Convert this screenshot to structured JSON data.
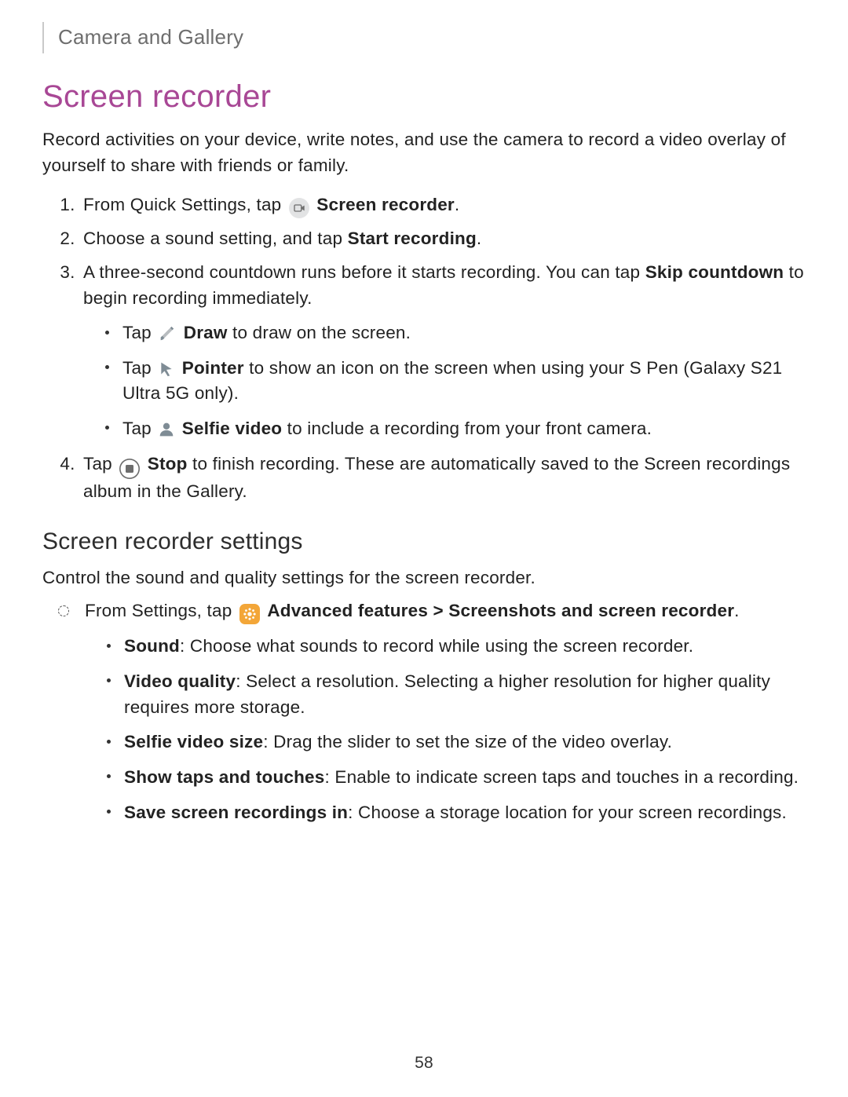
{
  "breadcrumb": "Camera and Gallery",
  "title": "Screen recorder",
  "intro": "Record activities on your device, write notes, and use the camera to record a video overlay of yourself to share with friends or family.",
  "steps": {
    "s1_pre": "From Quick Settings, tap ",
    "s1_label": "Screen recorder",
    "s1_post": ".",
    "s2_pre": "Choose a sound setting, and tap ",
    "s2_label": "Start recording",
    "s2_post": ".",
    "s3_pre": "A three-second countdown runs before it starts recording. You can tap ",
    "s3_label1": "Skip countdown",
    "s3_mid": " to begin recording immediately.",
    "s3_b1_pre": "Tap ",
    "s3_b1_label": "Draw",
    "s3_b1_post": " to draw on the screen.",
    "s3_b2_pre": "Tap ",
    "s3_b2_label": "Pointer",
    "s3_b2_post": " to show an icon on the screen when using your S Pen (Galaxy S21 Ultra 5G only).",
    "s3_b3_pre": "Tap ",
    "s3_b3_label": "Selfie video",
    "s3_b3_post": " to include a recording from your front camera.",
    "s4_pre": "Tap ",
    "s4_label": "Stop",
    "s4_post": " to finish recording. These are automatically saved to the Screen recordings album in the Gallery."
  },
  "subhead": "Screen recorder settings",
  "sub_intro": "Control the sound and quality settings for the screen recorder.",
  "settings_path": {
    "pre": "From Settings, tap ",
    "label": "Advanced features > Screenshots and screen recorder",
    "post": "."
  },
  "settings": {
    "b1_label": "Sound",
    "b1_text": ": Choose what sounds to record while using the screen recorder.",
    "b2_label": "Video quality",
    "b2_text": ": Select a resolution. Selecting a higher resolution for higher quality requires more storage.",
    "b3_label": "Selfie video size",
    "b3_text": ": Drag the slider to set the size of the video overlay.",
    "b4_label": "Show taps and touches",
    "b4_text": ": Enable to indicate screen taps and touches in a recording.",
    "b5_label": "Save screen recordings in",
    "b5_text": ": Choose a storage location for your screen recordings."
  },
  "page_number": "58"
}
